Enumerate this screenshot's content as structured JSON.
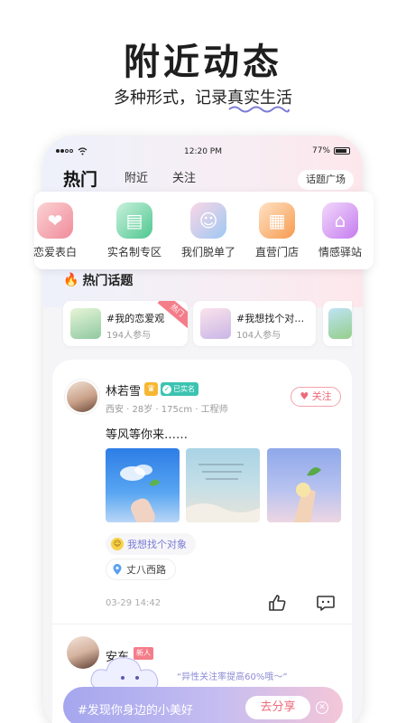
{
  "promo": {
    "headline": "附近动态",
    "subtitle_prefix": "多种形式，记录",
    "subtitle_highlight": "真实生活"
  },
  "status_bar": {
    "time": "12:20 PM",
    "battery": "77%"
  },
  "tabs": [
    {
      "label": "热门",
      "active": true
    },
    {
      "label": "附近",
      "active": false
    },
    {
      "label": "关注",
      "active": false
    }
  ],
  "topic_square_label": "话题广场",
  "categories": [
    {
      "label": "恋爱表白",
      "icon": "couple-hearts-icon",
      "color": "#f49aa6"
    },
    {
      "label": "实名制专区",
      "icon": "id-card-icon",
      "color": "#5fcf9c"
    },
    {
      "label": "我们脱单了",
      "icon": "couple-icon",
      "color": "#f4a6c2"
    },
    {
      "label": "直营门店",
      "icon": "store-icon",
      "color": "#f8a55e"
    },
    {
      "label": "情感驿站",
      "icon": "home-heart-icon",
      "color": "#d18cf0"
    }
  ],
  "hot_topics": {
    "title": "热门话题",
    "items": [
      {
        "title": "#我的恋爱观",
        "count": "194人参与",
        "badge": "热门"
      },
      {
        "title": "#我想找个对…",
        "count": "104人参与"
      }
    ]
  },
  "post": {
    "user_name": "林若雪",
    "verified_label": "已实名",
    "meta": "西安 · 28岁 · 175cm · 工程师",
    "follow_label": "关注",
    "text": "等风等你来……",
    "tag": "我想找个对象",
    "location": "丈八西路",
    "time": "03-29 14:42"
  },
  "next_post": {
    "user_name_partial": "安东",
    "badge": "新人"
  },
  "share_bar": {
    "promo_text": "“异性关注率提高60%哦～”",
    "prompt": "#发现你身边的小美好",
    "button_label": "去分享"
  },
  "colors": {
    "accent_pink": "#ee6a7a",
    "accent_purple": "#8c8cd6",
    "verified_green": "#3bc3b0"
  }
}
